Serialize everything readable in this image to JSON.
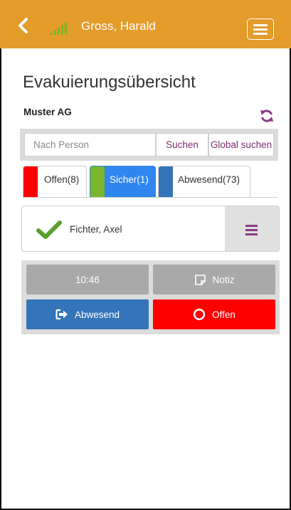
{
  "header": {
    "user_name": "Gross, Harald",
    "colors": {
      "bar": "#e39b2a",
      "signal": "#7ab52c"
    },
    "icons": [
      "back-chevron-icon",
      "signal-strength-icon",
      "hamburger-menu-icon"
    ]
  },
  "page": {
    "title": "Evakuierungsübersicht",
    "company": "Muster AG",
    "refresh_icon": "refresh-icon"
  },
  "search": {
    "placeholder": "Nach Person",
    "value": "",
    "search_label": "Suchen",
    "global_search_label": "Global suchen",
    "label_color": "#7b2d6b"
  },
  "tabs": [
    {
      "label": "Offen(8)",
      "color": "#ff0000",
      "active": false
    },
    {
      "label": "Sicher(1)",
      "color": "#7ab52c",
      "active": true
    },
    {
      "label": "Abwesend(73)",
      "color": "#3474b8",
      "active": false
    }
  ],
  "persons": [
    {
      "name": "Fichter, Axel",
      "status_icon": "check-icon",
      "status_color": "#5aa02c"
    }
  ],
  "actions": {
    "time_label": "10:46",
    "note_label": "Notiz",
    "away_label": "Abwesend",
    "open_label": "Offen",
    "colors": {
      "neutral": "#a9a9a9",
      "away": "#3474b8",
      "open": "#ff0000"
    }
  }
}
